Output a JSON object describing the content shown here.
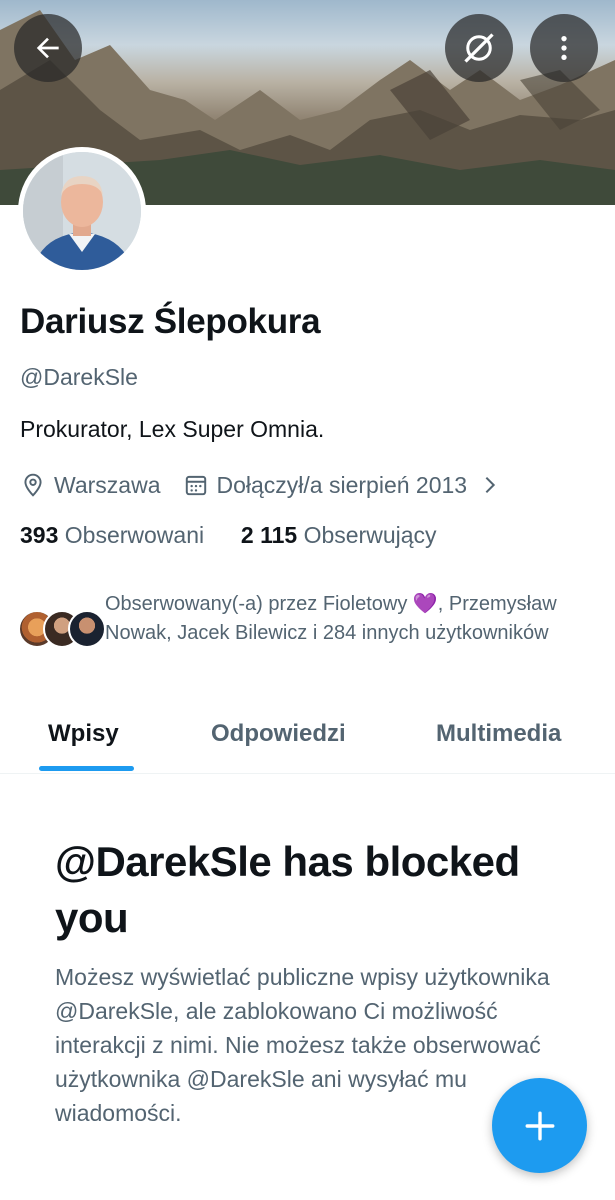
{
  "header": {
    "back_icon": "arrow-left-icon",
    "grok_icon": "grok-icon",
    "more_icon": "more-vertical-icon"
  },
  "profile": {
    "name": "Dariusz Ślepokura",
    "handle": "@DarekSle",
    "bio": "Prokurator, Lex Super Omnia.",
    "location": "Warszawa",
    "joined": "Dołączył/a sierpień 2013",
    "following_count": "393",
    "following_label": "Obserwowani",
    "followers_count": "2 115",
    "followers_label": "Obserwujący"
  },
  "followed_by": {
    "text": "Obserwowany(-a) przez Fioletowy 💜, Przemysław Nowak, Jacek Bilewicz i 284 innych użytkowników"
  },
  "tabs": [
    {
      "label": "Wpisy",
      "active": true
    },
    {
      "label": "Odpowiedzi",
      "active": false
    },
    {
      "label": "Multimedia",
      "active": false
    }
  ],
  "blocked": {
    "title": "@DarekSle has blocked you",
    "text": "Możesz wyświetlać publiczne wpisy użytkownika @DarekSle, ale zablokowano Ci możliwość interakcji z nimi. Nie możesz także obserwować użytkownika @DarekSle ani wysyłać mu wiadomości."
  },
  "fab": {
    "icon": "plus-icon"
  },
  "colors": {
    "accent": "#1d9bf0",
    "text_primary": "#0f1419",
    "text_secondary": "#536471"
  }
}
